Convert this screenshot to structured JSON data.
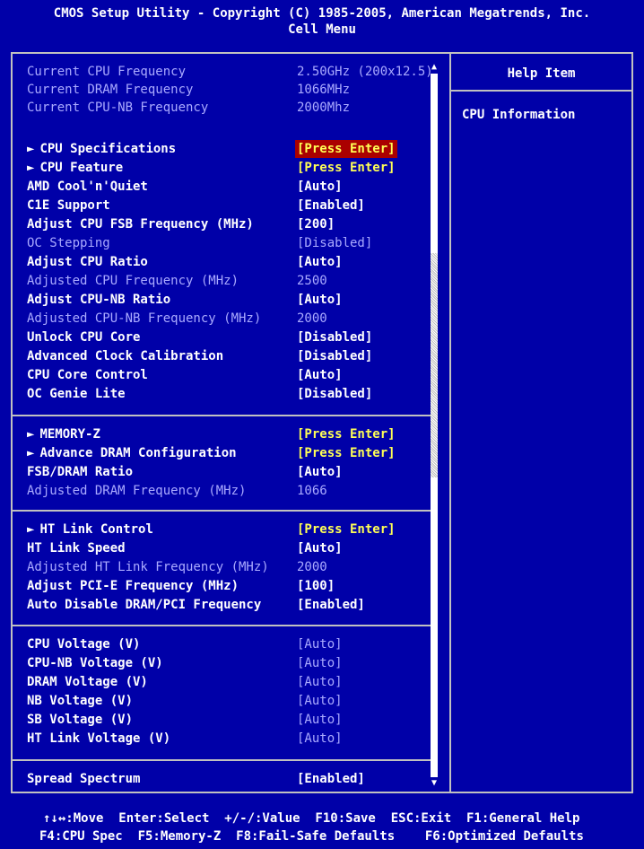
{
  "header": {
    "title": "CMOS Setup Utility - Copyright (C) 1985-2005, American Megatrends, Inc.",
    "subtitle": "Cell Menu"
  },
  "info": [
    {
      "label": "Current CPU Frequency",
      "value": "2.50GHz (200x12.5)"
    },
    {
      "label": "Current DRAM Frequency",
      "value": "1066MHz"
    },
    {
      "label": "Current CPU-NB Frequency",
      "value": "2000Mhz"
    }
  ],
  "cpu": [
    {
      "label": "CPU Specifications",
      "value": "[Press Enter]"
    },
    {
      "label": "CPU Feature",
      "value": "[Press Enter]"
    },
    {
      "label": "AMD Cool'n'Quiet",
      "value": "[Auto]"
    },
    {
      "label": "C1E Support",
      "value": "[Enabled]"
    },
    {
      "label": "Adjust CPU FSB Frequency (MHz)",
      "value": "[200]"
    },
    {
      "label": "OC Stepping",
      "value": "[Disabled]"
    },
    {
      "label": "Adjust CPU Ratio",
      "value": "[Auto]"
    },
    {
      "label": "Adjusted CPU Frequency (MHz)",
      "value": "2500"
    },
    {
      "label": "Adjust CPU-NB Ratio",
      "value": "[Auto]"
    },
    {
      "label": "Adjusted CPU-NB Frequency (MHz)",
      "value": "2000"
    },
    {
      "label": "Unlock CPU Core",
      "value": "[Disabled]"
    },
    {
      "label": "Advanced Clock Calibration",
      "value": "[Disabled]"
    },
    {
      "label": "CPU Core Control",
      "value": "[Auto]"
    },
    {
      "label": "OC Genie Lite",
      "value": "[Disabled]"
    }
  ],
  "memory": [
    {
      "label": "MEMORY-Z",
      "value": "[Press Enter]"
    },
    {
      "label": "Advance DRAM Configuration",
      "value": "[Press Enter]"
    },
    {
      "label": "FSB/DRAM Ratio",
      "value": "[Auto]"
    },
    {
      "label": "Adjusted DRAM Frequency (MHz)",
      "value": "1066"
    }
  ],
  "ht": [
    {
      "label": "HT Link Control",
      "value": "[Press Enter]"
    },
    {
      "label": "HT Link Speed",
      "value": "[Auto]"
    },
    {
      "label": "Adjusted HT Link Frequency (MHz)",
      "value": "2000"
    },
    {
      "label": "Adjust PCI-E Frequency (MHz)",
      "value": "[100]"
    },
    {
      "label": "Auto Disable DRAM/PCI Frequency",
      "value": "[Enabled]"
    }
  ],
  "voltage": [
    {
      "label": "CPU Voltage (V)",
      "value": "[Auto]"
    },
    {
      "label": "CPU-NB Voltage (V)",
      "value": "[Auto]"
    },
    {
      "label": "DRAM Voltage (V)",
      "value": "[Auto]"
    },
    {
      "label": "NB Voltage (V)",
      "value": "[Auto]"
    },
    {
      "label": "SB Voltage (V)",
      "value": "[Auto]"
    },
    {
      "label": "HT Link Voltage (V)",
      "value": "[Auto]"
    }
  ],
  "spread": {
    "label": "Spread Spectrum",
    "value": "[Enabled]"
  },
  "help": {
    "title": "Help Item",
    "text": "CPU Information"
  },
  "footer": {
    "line1": "↑↓↔:Move  Enter:Select  +/-/:Value  F10:Save  ESC:Exit  F1:General Help",
    "line2": "F4:CPU Spec  F5:Memory-Z  F8:Fail-Safe Defaults    F6:Optimized Defaults"
  },
  "colors": {
    "background": "#0000a8",
    "highlight": "#aa0000",
    "submenu_value": "#ffff55",
    "disabled": "#aaaaff"
  }
}
